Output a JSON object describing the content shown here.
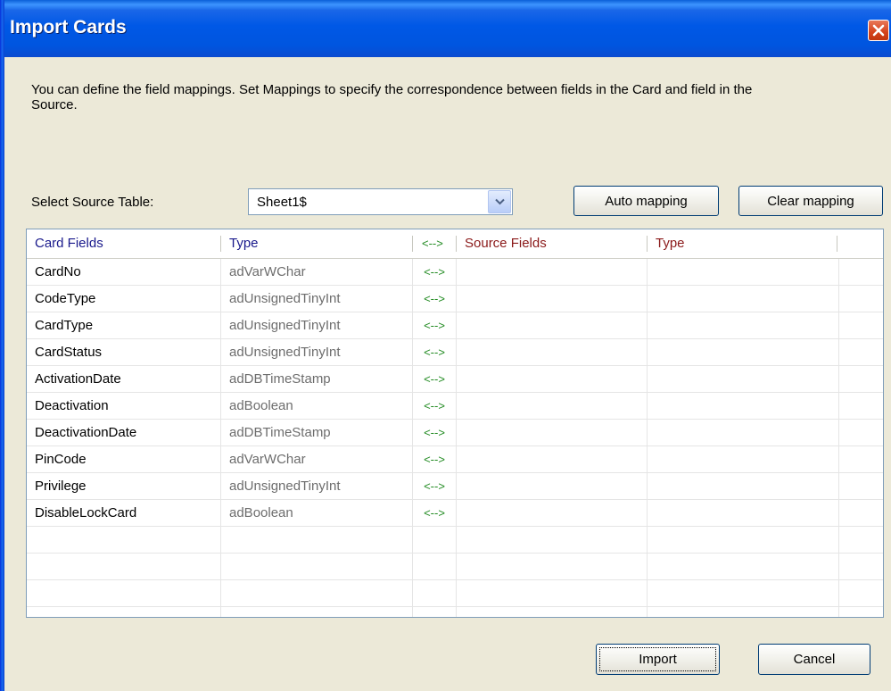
{
  "window": {
    "title": "Import Cards"
  },
  "description": "You can define the field mappings. Set Mappings to specify the correspondence between fields in the Card and field in the Source.",
  "source": {
    "label": "Select Source Table:",
    "selected": "Sheet1$"
  },
  "buttons": {
    "auto_mapping": "Auto mapping",
    "clear_mapping": "Clear mapping",
    "import": "Import",
    "cancel": "Cancel"
  },
  "grid": {
    "columns": [
      "Card Fields",
      "Type",
      "<-->",
      "Source Fields",
      "Type"
    ],
    "column_colors": [
      "#1a1a8c",
      "#1a1a8c",
      "#228b22",
      "#8b1a1a",
      "#8b1a1a"
    ],
    "rows": [
      {
        "field": "CardNo",
        "type": "adVarWChar",
        "map": "<-->",
        "source": "",
        "source_type": ""
      },
      {
        "field": "CodeType",
        "type": "adUnsignedTinyInt",
        "map": "<-->",
        "source": "",
        "source_type": ""
      },
      {
        "field": "CardType",
        "type": "adUnsignedTinyInt",
        "map": "<-->",
        "source": "",
        "source_type": ""
      },
      {
        "field": "CardStatus",
        "type": "adUnsignedTinyInt",
        "map": "<-->",
        "source": "",
        "source_type": ""
      },
      {
        "field": "ActivationDate",
        "type": "adDBTimeStamp",
        "map": "<-->",
        "source": "",
        "source_type": ""
      },
      {
        "field": "Deactivation",
        "type": "adBoolean",
        "map": "<-->",
        "source": "",
        "source_type": ""
      },
      {
        "field": "DeactivationDate",
        "type": "adDBTimeStamp",
        "map": "<-->",
        "source": "",
        "source_type": ""
      },
      {
        "field": "PinCode",
        "type": "adVarWChar",
        "map": "<-->",
        "source": "",
        "source_type": ""
      },
      {
        "field": "Privilege",
        "type": "adUnsignedTinyInt",
        "map": "<-->",
        "source": "",
        "source_type": ""
      },
      {
        "field": "DisableLockCard",
        "type": "adBoolean",
        "map": "<-->",
        "source": "",
        "source_type": ""
      },
      {
        "field": "",
        "type": "",
        "map": "",
        "source": "",
        "source_type": ""
      },
      {
        "field": "",
        "type": "",
        "map": "",
        "source": "",
        "source_type": ""
      },
      {
        "field": "",
        "type": "",
        "map": "",
        "source": "",
        "source_type": ""
      },
      {
        "field": "",
        "type": "",
        "map": "",
        "source": "",
        "source_type": ""
      }
    ]
  },
  "icons": {
    "close": "close-icon",
    "dropdown": "chevron-down-icon"
  }
}
